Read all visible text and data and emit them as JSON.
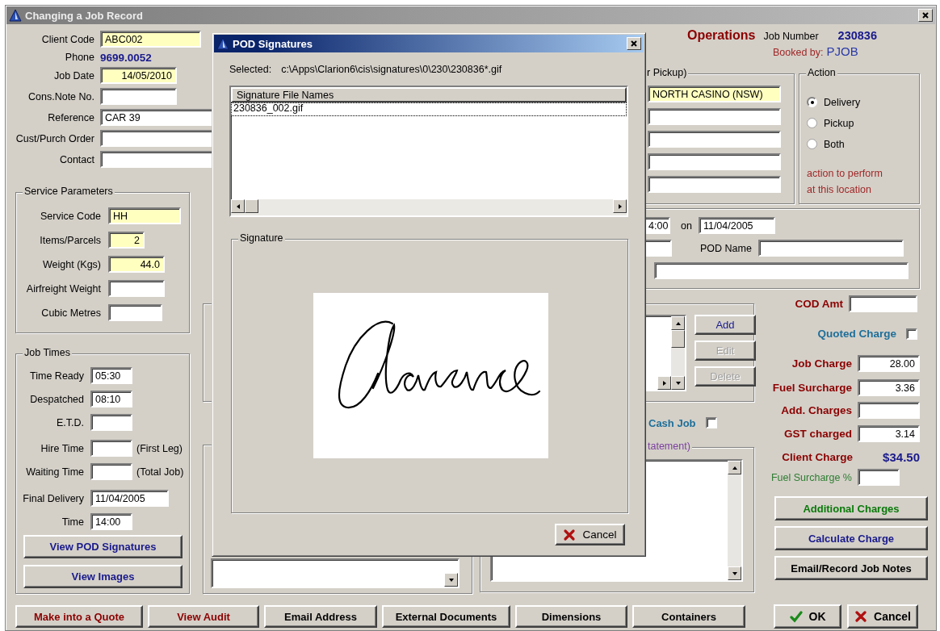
{
  "window": {
    "title": "Changing a Job Record"
  },
  "client": [
    {
      "label": "Client Code",
      "value": "ABC002",
      "highlighted": true,
      "kind": "text"
    },
    {
      "label": "Phone",
      "value": "9699.0052",
      "kind": "display"
    },
    {
      "label": "Job Date",
      "value": "14/05/2010",
      "highlighted": true,
      "kind": "number"
    },
    {
      "label": "Cons.Note No.",
      "highlighted": false,
      "kind": "text"
    },
    {
      "label": "Reference",
      "value": "CAR 39",
      "highlighted": false,
      "kind": "text"
    },
    {
      "label": "Cust/Purch Order",
      "highlighted": false,
      "kind": "text"
    },
    {
      "label": "Contact",
      "highlighted": false,
      "kind": "text"
    }
  ],
  "service": {
    "title": "Service Parameters",
    "fields": [
      {
        "label": "Service Code",
        "value": "HH",
        "highlighted": true,
        "kind": "text"
      },
      {
        "label": "Items/Parcels",
        "value": "2",
        "highlighted": true,
        "kind": "number"
      },
      {
        "label": "Weight (Kgs)",
        "value": "44.0",
        "highlighted": true,
        "kind": "number"
      },
      {
        "label": "Airfreight Weight",
        "highlighted": false,
        "kind": "number"
      },
      {
        "label": "Cubic Metres",
        "highlighted": false,
        "kind": "number"
      }
    ]
  },
  "job_times": {
    "title": "Job Times",
    "fields": [
      {
        "label": "Time Ready",
        "value": "05:30"
      },
      {
        "label": "Despatched",
        "value": "08:10"
      },
      {
        "label": "E.T.D."
      },
      {
        "label": "Hire Time",
        "note": "(First Leg)"
      },
      {
        "label": "Waiting Time",
        "note": "(Total Job)"
      },
      {
        "label": "Final Delivery",
        "value": "11/04/2005"
      },
      {
        "label": "Time",
        "value": "14:00"
      }
    ],
    "buttons": [
      {
        "label": "View POD Signatures",
        "kind": "primary"
      },
      {
        "label": "View Images",
        "kind": "primary"
      }
    ]
  },
  "header": {
    "department": "Operations",
    "job_number_label": "Job Number",
    "job_number": "230836",
    "booked_by_label": "Booked by:",
    "booked_by": "PJOB"
  },
  "address": {
    "legend": "r Pickup)",
    "lines": [
      {
        "value": "NORTH CASINO (NSW)",
        "highlighted": true
      },
      {
        "highlighted": false
      },
      {
        "highlighted": false
      },
      {
        "highlighted": false
      },
      {
        "highlighted": false
      }
    ]
  },
  "action": {
    "legend": "Action",
    "options": [
      {
        "label": "Delivery",
        "selected": true
      },
      {
        "label": "Pickup",
        "selected": false
      },
      {
        "label": "Both",
        "selected": false
      }
    ],
    "note": "action to perform at this location"
  },
  "pod_times": {
    "time": "4:00",
    "on_label": "on",
    "date": "11/04/2005",
    "pod_name_label": "POD Name"
  },
  "list_panel": {
    "buttons": [
      {
        "label": "Add",
        "disabled": false
      },
      {
        "label": "Edit",
        "disabled": true
      },
      {
        "label": "Delete",
        "disabled": true
      }
    ]
  },
  "cash_job": {
    "label": "Cash Job",
    "checked": false
  },
  "statement": {
    "legend": "tatement)"
  },
  "charges": [
    {
      "kind": "field",
      "label": "COD Amt"
    },
    {
      "kind": "checkbox",
      "label": "Quoted Charge",
      "checked": false
    },
    {
      "kind": "field",
      "label": "Job Charge",
      "value": "28.00"
    },
    {
      "kind": "field",
      "label": "Fuel Surcharge",
      "value": "3.36"
    },
    {
      "kind": "field",
      "label": "Add. Charges"
    },
    {
      "kind": "field",
      "label": "GST charged",
      "value": "3.14"
    },
    {
      "kind": "total",
      "label": "Client Charge",
      "value": "$34.50"
    },
    {
      "kind": "percent",
      "label": "Fuel Surcharge %"
    }
  ],
  "charge_buttons": [
    {
      "label": "Additional Charges",
      "kind": "success"
    },
    {
      "label": "Calculate Charge",
      "kind": "primary"
    },
    {
      "label": "Email/Record Job Notes",
      "kind": "plain"
    }
  ],
  "bottom_buttons": [
    {
      "label": "Make into a Quote",
      "kind": "danger"
    },
    {
      "label": "View Audit",
      "kind": "danger"
    },
    {
      "label": "Email Address",
      "kind": "plain"
    },
    {
      "label": "External Documents",
      "kind": "plain"
    },
    {
      "label": "Dimensions",
      "kind": "plain"
    },
    {
      "label": "Containers",
      "kind": "plain"
    }
  ],
  "dialog_buttons": [
    {
      "label": "OK",
      "kind": "ok"
    },
    {
      "label": "Cancel",
      "kind": "cancel"
    }
  ],
  "pod_dialog": {
    "title": "POD Signatures",
    "selected_label": "Selected:",
    "selected_path": "c:\\Apps\\Clarion6\\cis\\signatures\\0\\230\\230836*.gif",
    "list_header": "Signature File Names",
    "files": [
      {
        "name": "230836_002.gif",
        "selected": true
      }
    ],
    "signature_legend": "Signature",
    "cancel": "Cancel"
  }
}
